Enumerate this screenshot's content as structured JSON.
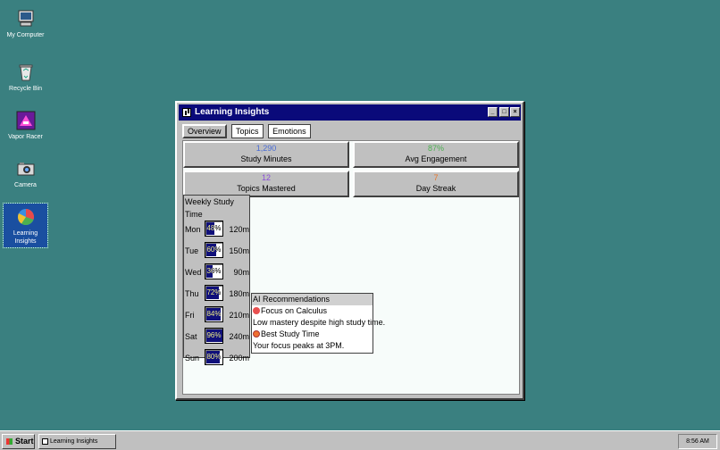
{
  "desktop": {
    "icons": [
      {
        "label": "My Computer",
        "icon": "computer-icon"
      },
      {
        "label": "Recycle Bin",
        "icon": "recycle-bin-icon"
      },
      {
        "label": "Vapor Racer",
        "icon": "game-icon"
      },
      {
        "label": "Camera",
        "icon": "camera-icon"
      },
      {
        "label": "Learning Insights",
        "icon": "pie-chart-icon"
      }
    ]
  },
  "window": {
    "title": "Learning Insights",
    "buttons": {
      "minimize": "_",
      "maximize": "□",
      "close": "×"
    },
    "tabs": [
      "Overview",
      "Topics",
      "Emotions"
    ],
    "active_tab": "Overview",
    "stats": [
      {
        "value": "1,290",
        "label": "Study Minutes",
        "color": "#4a6cd4"
      },
      {
        "value": "87%",
        "label": "Avg Engagement",
        "color": "#4caf50"
      },
      {
        "value": "12",
        "label": "Topics Mastered",
        "color": "#8a4fd8"
      },
      {
        "value": "7",
        "label": "Day Streak",
        "color": "#e8752a"
      }
    ],
    "weekly": {
      "title": "Weekly Study Time",
      "days": [
        {
          "day": "Mon",
          "pct": 48,
          "pct_label": "48%",
          "minutes": "120m"
        },
        {
          "day": "Tue",
          "pct": 60,
          "pct_label": "60%",
          "minutes": "150m"
        },
        {
          "day": "Wed",
          "pct": 36,
          "pct_label": "36%",
          "minutes": "90m"
        },
        {
          "day": "Thu",
          "pct": 72,
          "pct_label": "72%",
          "minutes": "180m"
        },
        {
          "day": "Fri",
          "pct": 84,
          "pct_label": "84%",
          "minutes": "210m"
        },
        {
          "day": "Sat",
          "pct": 96,
          "pct_label": "96%",
          "minutes": "240m"
        },
        {
          "day": "Sun",
          "pct": 80,
          "pct_label": "80%",
          "minutes": "200m"
        }
      ]
    },
    "recommendations": {
      "title": "AI Recommendations",
      "items": [
        {
          "icon": "target-icon",
          "heading": "Focus on Calculus",
          "text": "Low mastery despite high study time."
        },
        {
          "icon": "alarm-clock-icon",
          "heading": "Best Study Time",
          "text": "Your focus peaks at 3PM."
        }
      ]
    }
  },
  "taskbar": {
    "start_label": "Start",
    "task_label": "Learning Insights",
    "clock": "8:56 AM"
  }
}
